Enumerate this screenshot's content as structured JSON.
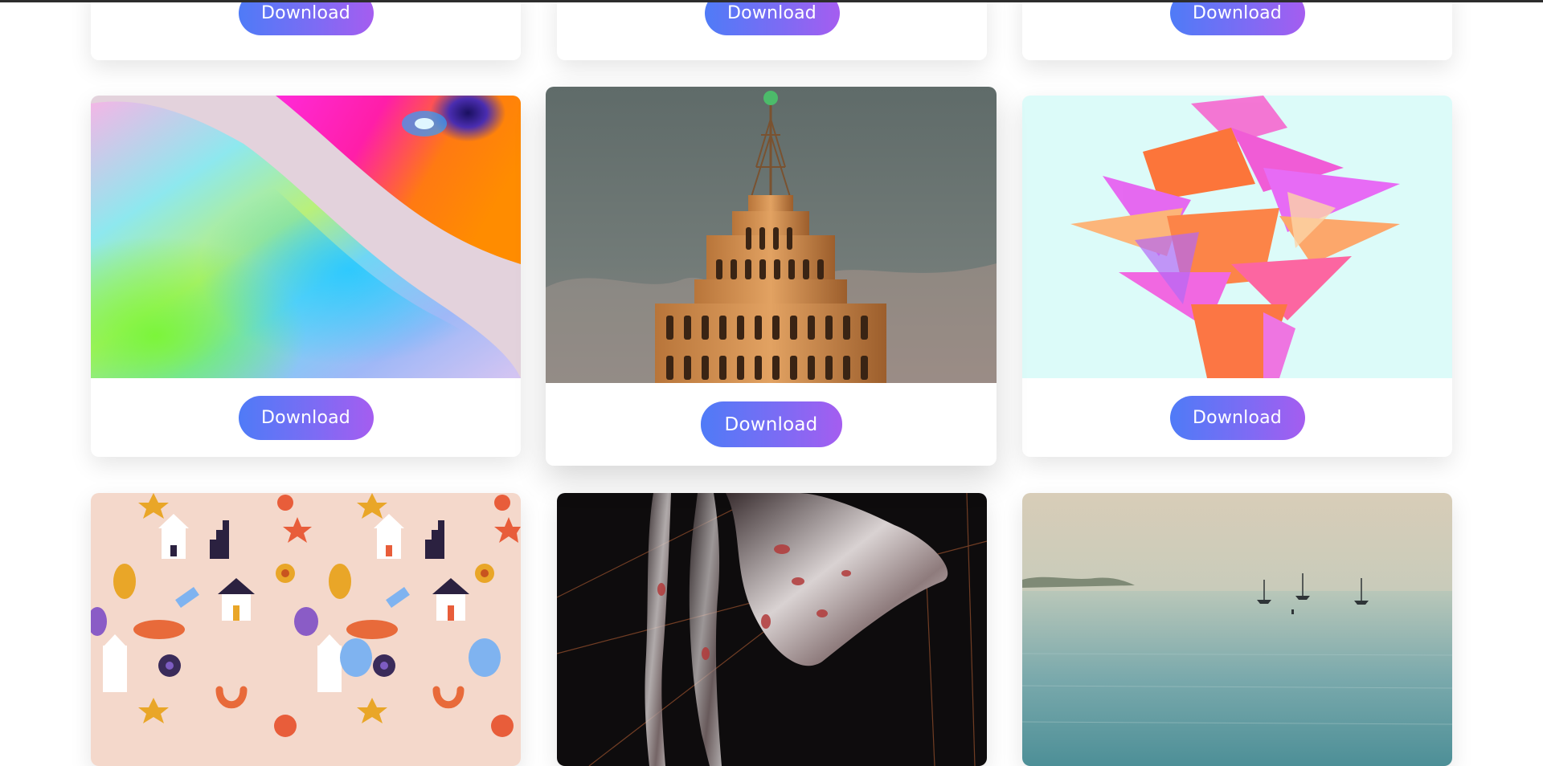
{
  "page": {
    "download_label": "Download"
  },
  "colors": {
    "button_gradient_start": "#4f7bf7",
    "button_gradient_end": "#a55df0",
    "card_background": "#ffffff",
    "top_bar": "#2d2d2d"
  },
  "gallery": {
    "row_top": [
      {
        "button_label": "Download"
      },
      {
        "button_label": "Download"
      },
      {
        "button_label": "Download"
      }
    ],
    "row_middle": [
      {
        "image": "holographic-gradient-abstract",
        "button_label": "Download"
      },
      {
        "image": "art-deco-skyscraper-tower",
        "button_label": "Download"
      },
      {
        "image": "pink-orange-polygon-shards",
        "button_label": "Download"
      }
    ],
    "row_bottom": [
      {
        "image": "cute-houses-flowers-pattern"
      },
      {
        "image": "dark-liquid-metal-abstract"
      },
      {
        "image": "sea-sailboats-haze"
      }
    ]
  }
}
